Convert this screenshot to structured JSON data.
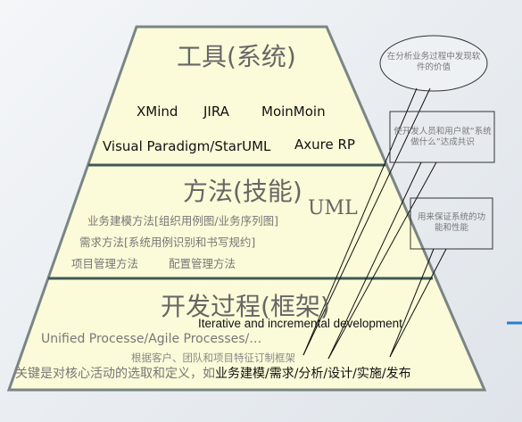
{
  "layers": {
    "tools": {
      "title": "工具(系统)",
      "items": [
        "XMind",
        "JIRA",
        "MoinMoin",
        "Visual Paradigm/StarUML",
        "Axure RP"
      ]
    },
    "methods": {
      "title": "方法(技能)",
      "uml": "UML",
      "items": [
        "业务建模方法[组织用例图/业务序列图]",
        "需求方法[系统用例识别和书写规约]",
        "项目管理方法",
        "配置管理方法"
      ]
    },
    "process": {
      "title": "开发过程(框架)",
      "iterative": "Iterative and incremental development",
      "processes": "Unified Processe/Agile Processes/…",
      "customize": "根据客户、团队和项目特征订制框架",
      "key_prefix": "关键是对核心活动的选取和定义，如",
      "key_activities": "业务建模/需求/分析/设计/实施/发布"
    }
  },
  "callouts": [
    "在分析业务过程中发现软件的价值",
    "使开发人员和用户就“系统做什么”达成共识",
    "用来保证系统的功能和性能"
  ],
  "colors": {
    "fill": "#fbfbd9",
    "stroke": "#7a8585",
    "divider": "#3f5a55",
    "accent": "#2a7fd0"
  }
}
